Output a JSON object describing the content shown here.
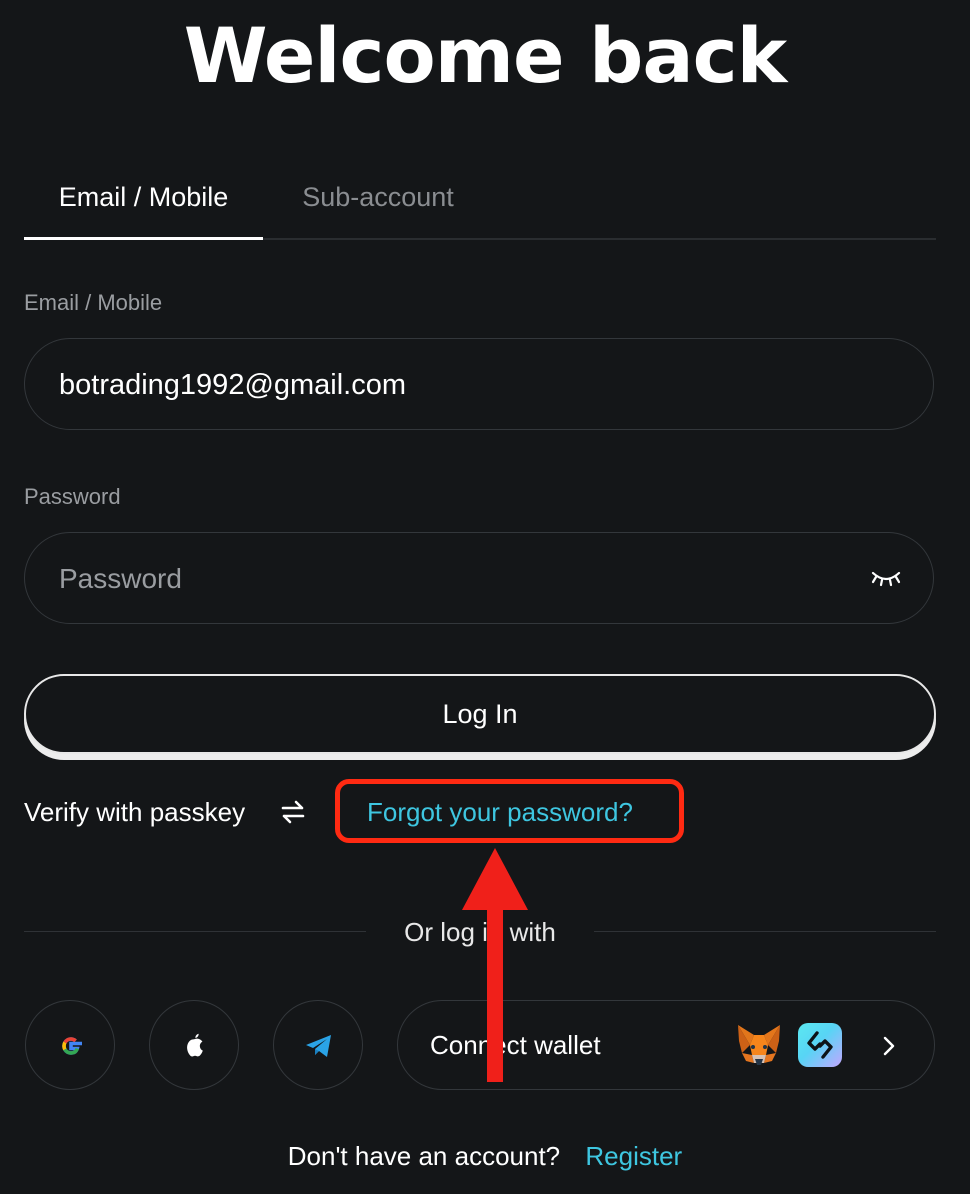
{
  "title": "Welcome back",
  "tabs": [
    {
      "label": "Email / Mobile",
      "active": true
    },
    {
      "label": "Sub-account",
      "active": false
    }
  ],
  "email": {
    "label": "Email / Mobile",
    "value": "botrading1992@gmail.com"
  },
  "password": {
    "label": "Password",
    "placeholder": "Password"
  },
  "login_button": "Log In",
  "passkey_label": "Verify with passkey",
  "forgot_password": "Forgot your password?",
  "divider_text": "Or log in with",
  "social": {
    "google": "google-icon",
    "apple": "apple-icon",
    "telegram": "telegram-icon"
  },
  "wallet": {
    "label": "Connect wallet"
  },
  "footer": {
    "question": "Don't have an account?",
    "register": "Register"
  },
  "colors": {
    "background": "#141618",
    "accent_link": "#3ec6e0",
    "annotation_red": "#ff2a12"
  }
}
